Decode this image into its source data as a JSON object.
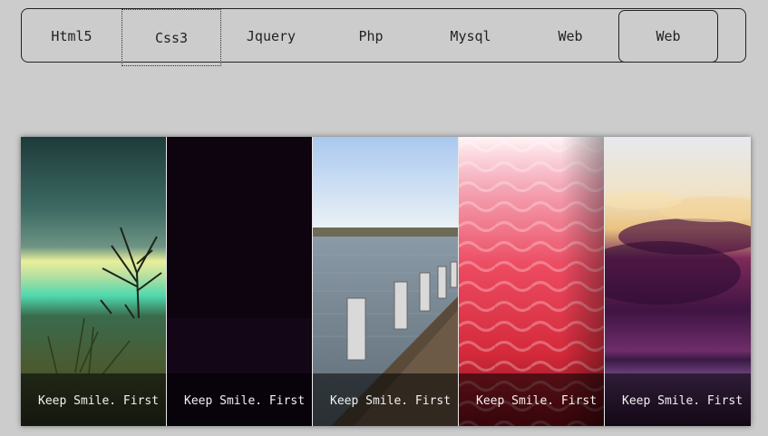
{
  "nav": {
    "items": [
      {
        "label": "Html5"
      },
      {
        "label": "Css3"
      },
      {
        "label": "Jquery"
      },
      {
        "label": "Php"
      },
      {
        "label": "Mysql"
      },
      {
        "label": "Web"
      },
      {
        "label": "Web"
      }
    ],
    "focused_index": 1,
    "active_index": 6
  },
  "gallery": {
    "panels": [
      {
        "caption": "Keep Smile. First",
        "image": "swamp-tree-image"
      },
      {
        "caption": "Keep Smile. First",
        "image": "dark-image"
      },
      {
        "caption": "Keep Smile. First",
        "image": "pier-image"
      },
      {
        "caption": "Keep Smile. First",
        "image": "red-wave-pattern-image"
      },
      {
        "caption": "Keep Smile. First",
        "image": "purple-sunset-image"
      }
    ]
  }
}
